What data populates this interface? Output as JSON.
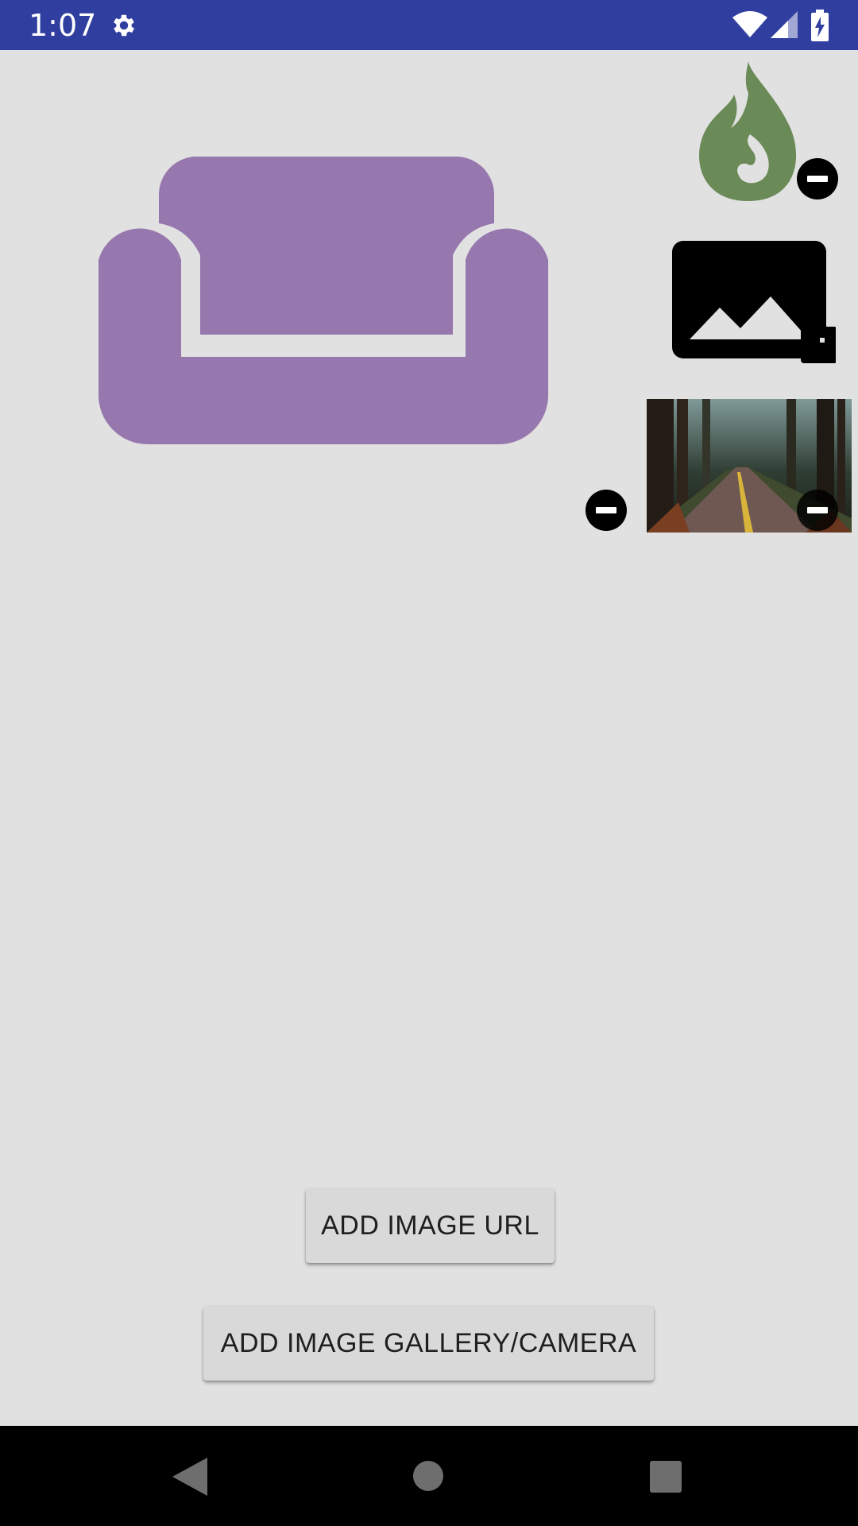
{
  "status_bar": {
    "time": "1:07",
    "icons": [
      "gear-icon",
      "wifi-icon",
      "cell-signal-icon",
      "battery-charging-icon"
    ]
  },
  "main": {
    "selected_image_icon": "couch-icon",
    "thumbnails": [
      {
        "icon": "fire-drop-icon",
        "color": "#6a8a57"
      },
      {
        "icon": "image-placeholder-icon",
        "color": "#000000"
      },
      {
        "icon": "forest-road-photo"
      }
    ],
    "colors": {
      "couch": "#9677ae",
      "background": "#e1e1e1",
      "status_bar": "#303f9f"
    }
  },
  "buttons": {
    "add_url": "ADD IMAGE URL",
    "add_gallery": "ADD IMAGE GALLERY/CAMERA"
  },
  "nav_bar": {
    "icons": [
      "back-icon",
      "home-icon",
      "recents-icon"
    ]
  }
}
